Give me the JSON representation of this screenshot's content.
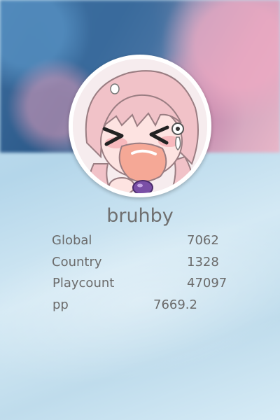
{
  "profile": {
    "username": "bruhby",
    "stats": [
      {
        "label": "Global",
        "value": "7062"
      },
      {
        "label": "Country",
        "value": "1328"
      },
      {
        "label": "Playcount",
        "value": "47097"
      },
      {
        "label": "pp",
        "value": "7669.2"
      }
    ]
  },
  "icons": {
    "avatar": "anime-girl-crying-avatar"
  },
  "colors": {
    "text": "#6b6b6b",
    "avatar_ring": "#ffffff",
    "background": "#c9e3f1"
  }
}
